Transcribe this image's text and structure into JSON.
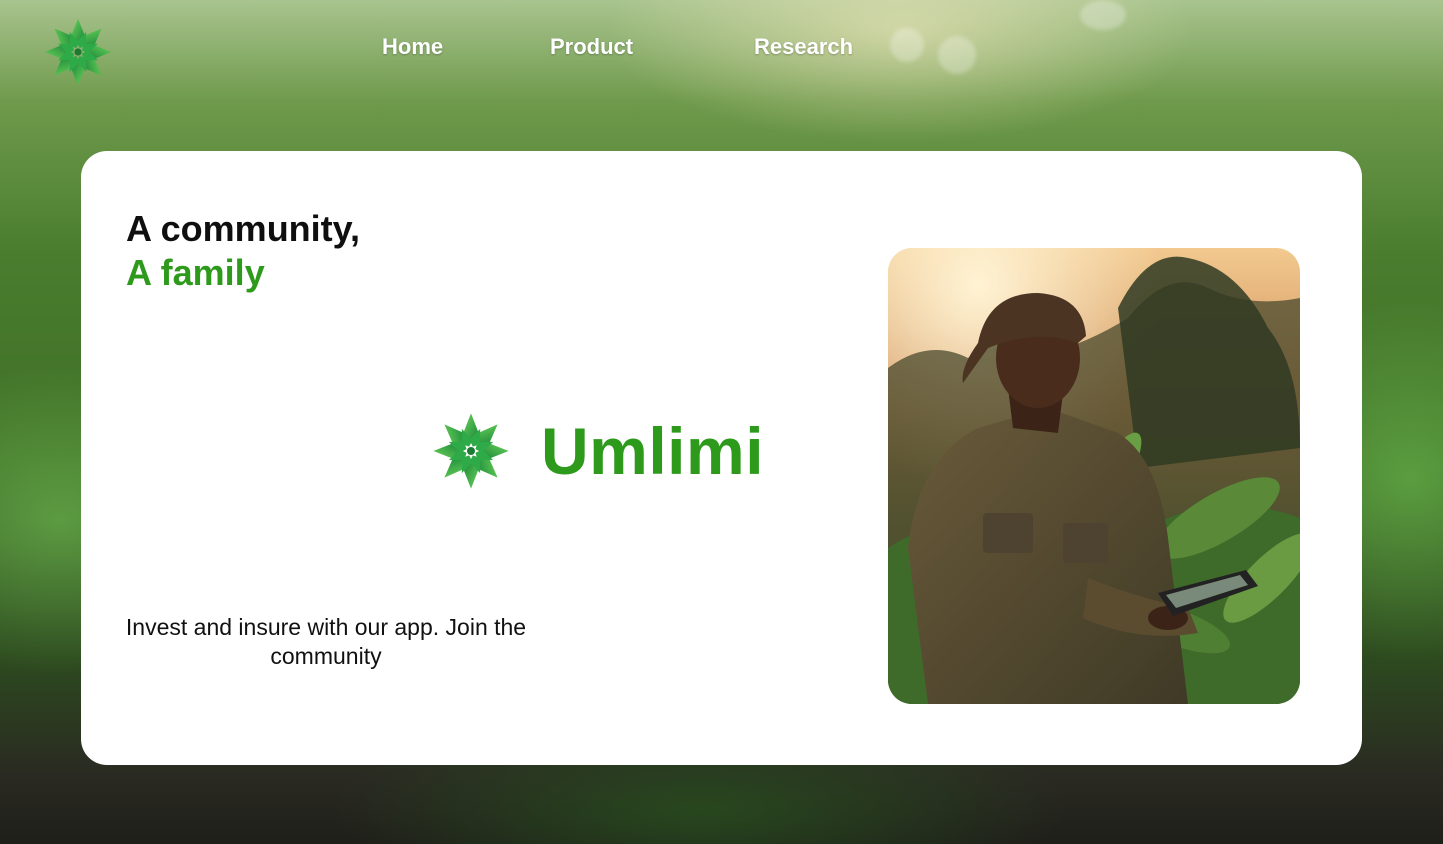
{
  "brand": {
    "name": "Umlimi",
    "logo_icon": "green-flower-icon"
  },
  "nav": {
    "items": [
      {
        "label": "Home"
      },
      {
        "label": "Product"
      },
      {
        "label": "Research"
      }
    ]
  },
  "hero": {
    "headline_line1": "A community,",
    "headline_line2": "A family",
    "tagline": "Invest and insure with our app. Join the community",
    "photo_alt": ""
  },
  "colors": {
    "accent_green": "#2e9a1c",
    "nav_text": "#ffffff",
    "card_background": "#ffffff"
  }
}
